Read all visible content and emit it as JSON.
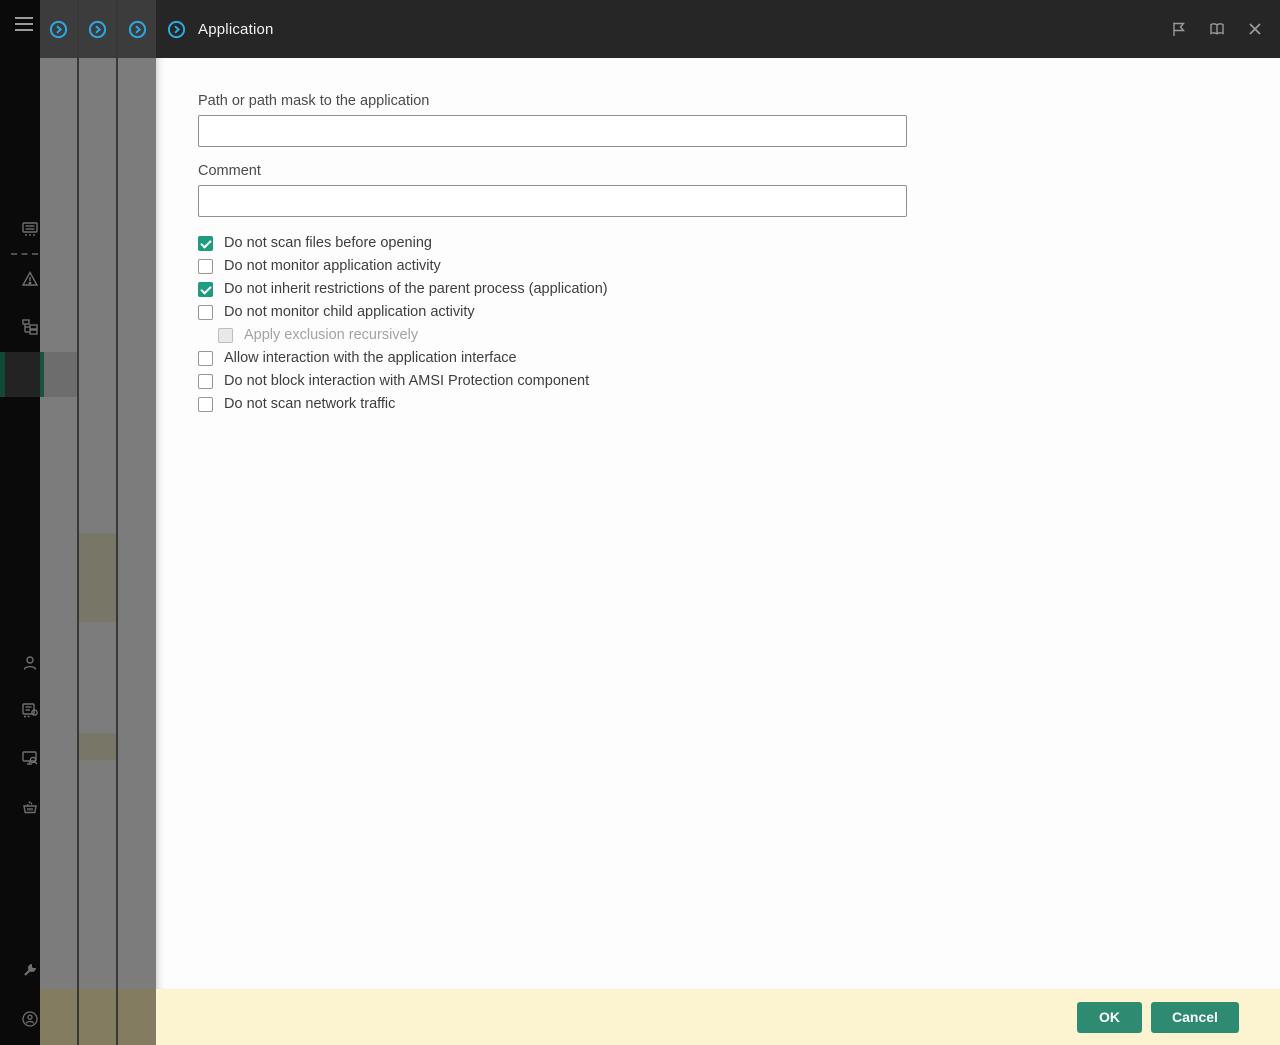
{
  "titlebar": {
    "title": "Application",
    "dialog_icon": "circle-chevron-icon",
    "flag_icon": "flag-icon",
    "manual_icon": "open-book-icon",
    "close_icon": "close-icon"
  },
  "stacked_dialogs": [
    {
      "icon": "circle-chevron-icon"
    },
    {
      "icon": "circle-chevron-icon"
    },
    {
      "icon": "circle-chevron-icon"
    }
  ],
  "sidebar": {
    "menu_icon": "hamburger-menu-icon",
    "item_icons": [
      "monitoring-icon",
      "warning-triangle-icon",
      "tree-structure-icon",
      "user-icon",
      "list-settings-icon",
      "device-search-icon",
      "basket-icon",
      "wrench-icon",
      "support-person-icon"
    ]
  },
  "form": {
    "path_label": "Path or path mask to the application",
    "path_value": "",
    "comment_label": "Comment",
    "comment_value": "",
    "checkboxes": [
      {
        "label": "Do not scan files before opening",
        "checked": true,
        "disabled": false,
        "indented": false
      },
      {
        "label": "Do not monitor application activity",
        "checked": false,
        "disabled": false,
        "indented": false
      },
      {
        "label": "Do not inherit restrictions of the parent process (application)",
        "checked": true,
        "disabled": false,
        "indented": false
      },
      {
        "label": "Do not monitor child application activity",
        "checked": false,
        "disabled": false,
        "indented": false
      },
      {
        "label": "Apply exclusion recursively",
        "checked": false,
        "disabled": true,
        "indented": true
      },
      {
        "label": "Allow interaction with the application interface",
        "checked": false,
        "disabled": false,
        "indented": false
      },
      {
        "label": "Do not block interaction with AMSI Protection component",
        "checked": false,
        "disabled": false,
        "indented": false
      },
      {
        "label": "Do not scan network traffic",
        "checked": false,
        "disabled": false,
        "indented": false
      }
    ]
  },
  "footer": {
    "ok_label": "OK",
    "cancel_label": "Cancel"
  },
  "colors": {
    "checkbox_teal": "#1f9c7f",
    "button_teal": "#2e8b72",
    "icon_blue": "#2da7e0",
    "footer_cream": "#fcf4d0",
    "titlebar_dark": "#262626"
  }
}
